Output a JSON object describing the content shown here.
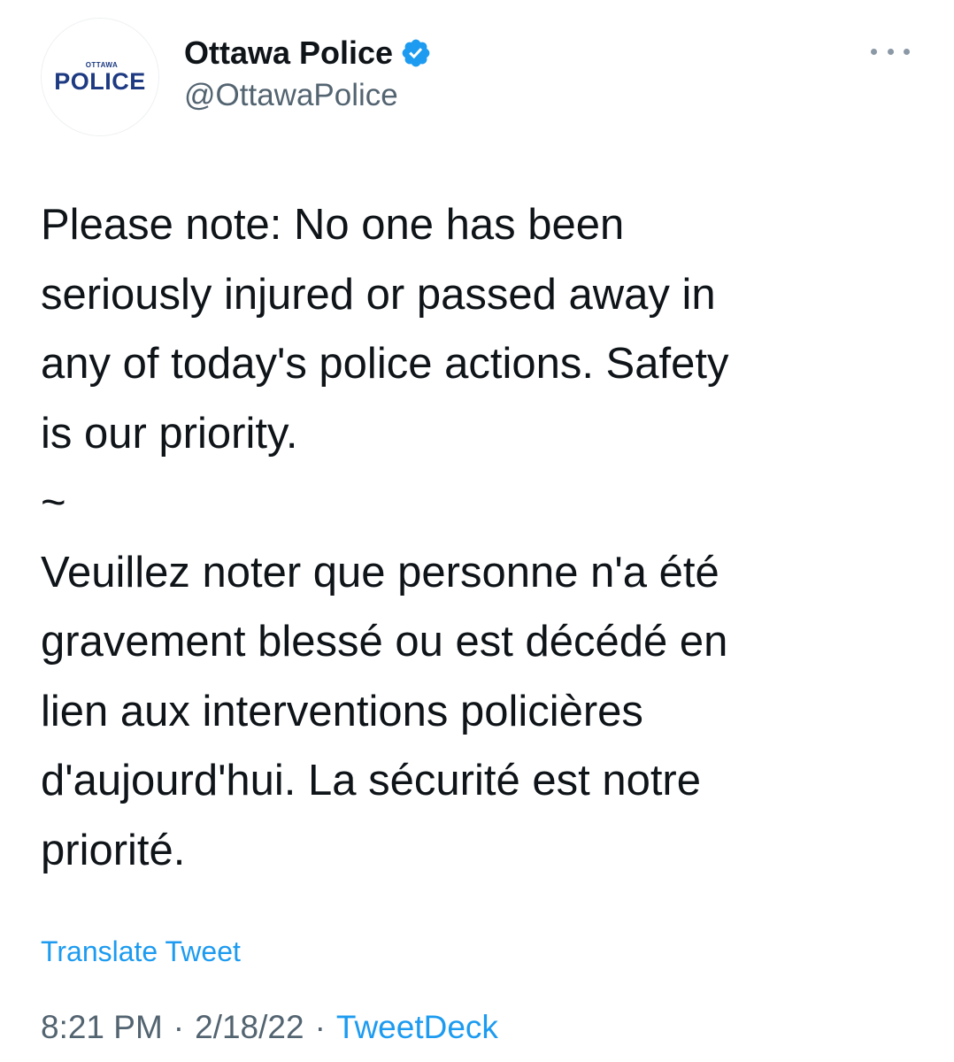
{
  "author": {
    "display_name": "Ottawa Police",
    "handle": "@OttawaPolice",
    "verified": true,
    "avatar_logo_top": "OTTAWA",
    "avatar_logo_main": "POLICE"
  },
  "tweet": {
    "text_en": "Please note: No one has been\nseriously injured or passed away in\nany of today's police actions. Safety\nis our priority.",
    "separator": "~",
    "text_fr": "Veuillez noter que personne n'a été\ngravement blessé ou est décédé en\nlien aux interventions policières\nd'aujourd'hui. La sécurité est notre\npriorité.",
    "translate_label": "Translate Tweet"
  },
  "meta": {
    "time": "8:21 PM",
    "date": "2/18/22",
    "source": "TweetDeck",
    "separator": "·"
  },
  "icons": {
    "verified": "verified-badge-icon",
    "more": "more-horizontal-icon"
  },
  "colors": {
    "accent": "#1d9bf0",
    "secondary_text": "#536471",
    "primary_text": "#0f1419",
    "logo_blue": "#1d3a82"
  }
}
